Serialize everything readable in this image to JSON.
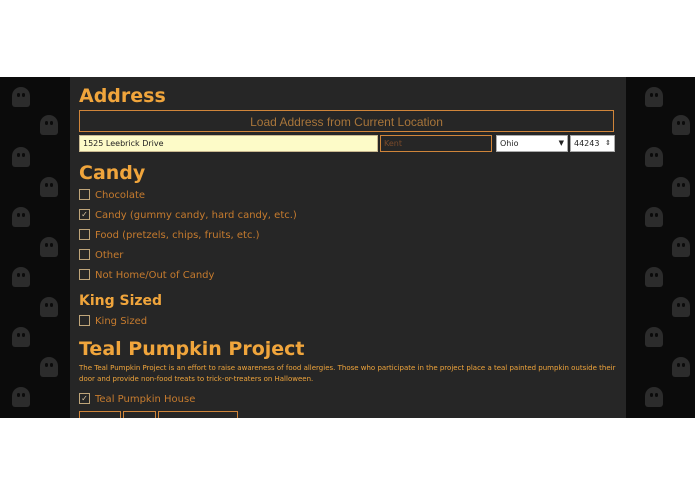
{
  "address": {
    "heading": "Address",
    "load_button": "Load Address from Current Location",
    "street_value": "1525 Leebrick Drive",
    "city_placeholder": "Kent",
    "state_value": "Ohio",
    "zip_value": "44243"
  },
  "candy": {
    "heading": "Candy",
    "options": [
      {
        "label": "Chocolate",
        "checked": false
      },
      {
        "label": "Candy (gummy candy, hard candy, etc.)",
        "checked": true
      },
      {
        "label": "Food (pretzels, chips, fruits, etc.)",
        "checked": false
      },
      {
        "label": "Other",
        "checked": false
      },
      {
        "label": "Not Home/Out of Candy",
        "checked": false
      }
    ]
  },
  "king_sized": {
    "heading": "King Sized",
    "option": {
      "label": "King Sized",
      "checked": false
    }
  },
  "teal_pumpkin": {
    "heading": "Teal Pumpkin Project",
    "description": "The Teal Pumpkin Project is an effort to raise awareness of food allergies. Those who participate in the project place a teal painted pumpkin outside their door and provide non-food treats to trick-or-treaters on Halloween.",
    "option": {
      "label": "Teal Pumpkin House",
      "checked": true
    }
  },
  "colors": {
    "accent": "#f0a53c",
    "panel": "#262626",
    "background": "#0b0b0b"
  }
}
